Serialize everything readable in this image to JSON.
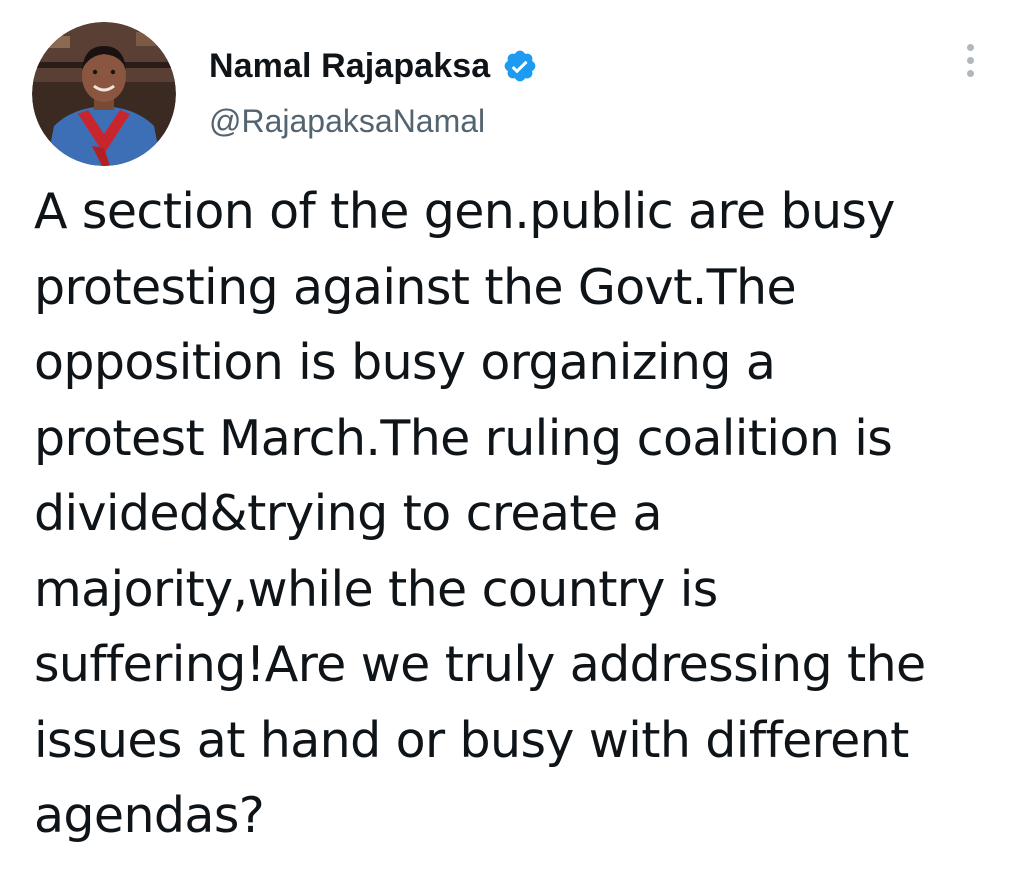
{
  "tweet": {
    "author": {
      "display_name": "Namal Rajapaksa",
      "handle": "@RajapaksaNamal",
      "verified": true,
      "avatar_icon": "profile-photo"
    },
    "text": "A section of the gen.public are busy\nprotesting against the Govt.The\nopposition is busy organizing a\nprotest March.The ruling coalition is\ndivided&trying to create a\nmajority,while the country is\nsuffering!Are we truly addressing the\nissues at hand or busy with different\nagendas?",
    "menu_icon": "more-vertical-icon",
    "colors": {
      "verified_badge": "#1d9bf0",
      "handle": "#536471",
      "text": "#0f1419"
    }
  }
}
